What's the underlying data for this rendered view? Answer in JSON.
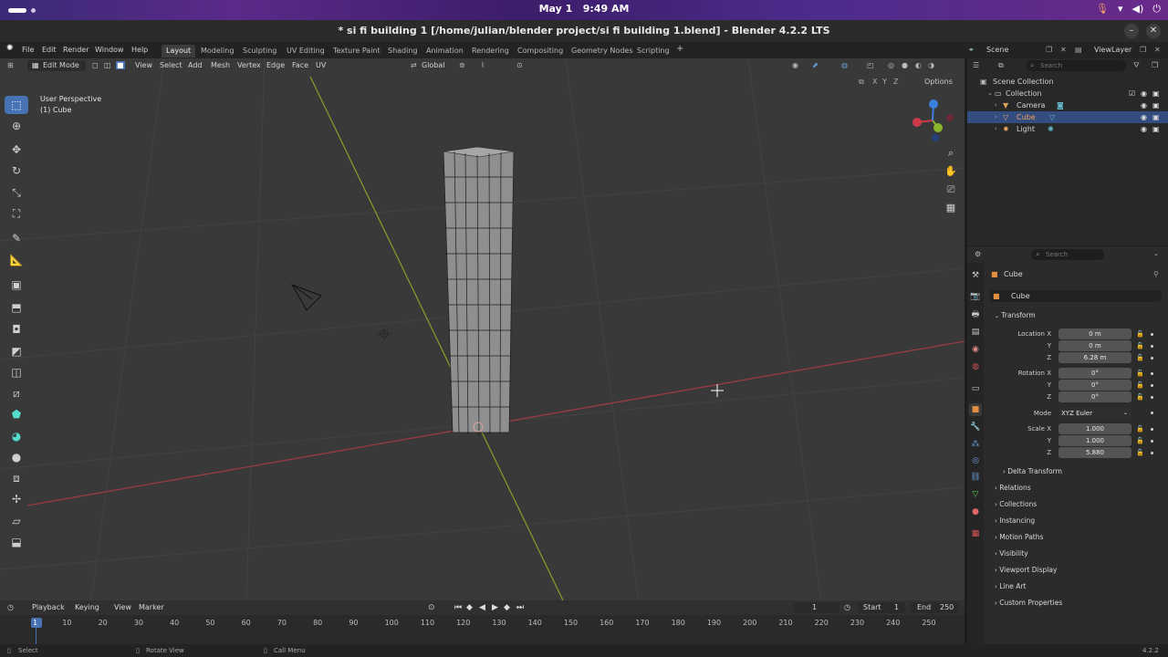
{
  "system": {
    "date": "May 1",
    "time": "9:49 AM"
  },
  "window": {
    "title": "* si fi building 1 [/home/julian/blender project/si fi building 1.blend] - Blender 4.2.2 LTS"
  },
  "menu": {
    "items": [
      "File",
      "Edit",
      "Render",
      "Window",
      "Help"
    ],
    "workspaces": [
      "Layout",
      "Modeling",
      "Sculpting",
      "UV Editing",
      "Texture Paint",
      "Shading",
      "Animation",
      "Rendering",
      "Compositing",
      "Geometry Nodes",
      "Scripting"
    ],
    "active_workspace": "Layout",
    "add_tab": "+",
    "scene": "Scene",
    "view_layer": "ViewLayer"
  },
  "viewport": {
    "mode": "Edit Mode",
    "menus": [
      "View",
      "Select",
      "Add",
      "Mesh",
      "Vertex",
      "Edge",
      "Face",
      "UV"
    ],
    "orientation": "Global",
    "options": "Options",
    "perspective": "User Perspective",
    "object": "(1) Cube",
    "axis_xyz": [
      "X",
      "Y",
      "Z"
    ]
  },
  "outliner": {
    "search_placeholder": "Search",
    "rows": [
      {
        "label": "Scene Collection"
      },
      {
        "label": "Collection"
      },
      {
        "label": "Camera"
      },
      {
        "label": "Cube"
      },
      {
        "label": "Light"
      }
    ]
  },
  "properties": {
    "search_placeholder": "Search",
    "object_name": "Cube",
    "data_name": "Cube",
    "transform_label": "Transform",
    "location_label": "Location X",
    "location": [
      "0 m",
      "0 m",
      "6.28 m"
    ],
    "rotation_label": "Rotation X",
    "rotation": [
      "0°",
      "0°",
      "0°"
    ],
    "mode_label": "Mode",
    "mode_value": "XYZ Euler",
    "scale_label": "Scale X",
    "scale": [
      "1.000",
      "1.000",
      "5.880"
    ],
    "axis_labels": [
      "Y",
      "Z"
    ],
    "sections": [
      "Delta Transform",
      "Relations",
      "Collections",
      "Instancing",
      "Motion Paths",
      "Visibility",
      "Viewport Display",
      "Line Art",
      "Custom Properties"
    ]
  },
  "timeline": {
    "menus": [
      "Playback",
      "Keying",
      "View",
      "Marker"
    ],
    "current_frame": "1",
    "start_label": "Start",
    "start": "1",
    "end_label": "End",
    "end": "250",
    "ticks": [
      "1",
      "10",
      "20",
      "30",
      "40",
      "50",
      "60",
      "70",
      "80",
      "90",
      "100",
      "110",
      "120",
      "130",
      "140",
      "150",
      "160",
      "170",
      "180",
      "190",
      "200",
      "210",
      "220",
      "230",
      "240",
      "250"
    ]
  },
  "status": {
    "select": "Select",
    "rotate": "Rotate View",
    "call_menu": "Call Menu",
    "version": "4.2.2"
  }
}
